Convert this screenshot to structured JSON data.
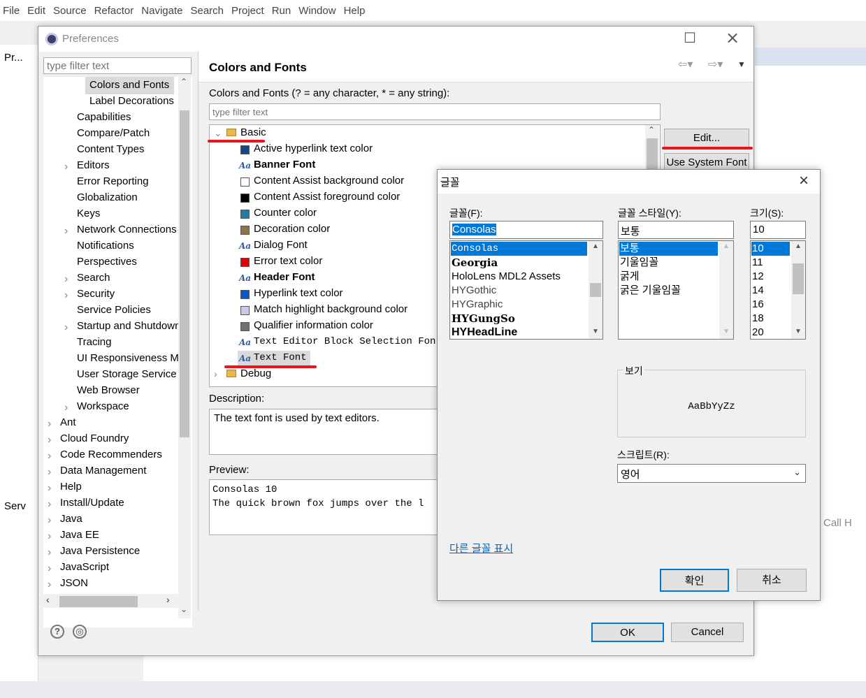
{
  "menu": [
    "File",
    "Edit",
    "Source",
    "Refactor",
    "Navigate",
    "Search",
    "Project",
    "Run",
    "Window",
    "Help"
  ],
  "background": {
    "left_tab": "Pr...",
    "servers_tab": "Serv",
    "call_hierarchy": "Call H"
  },
  "prefs": {
    "title": "Preferences",
    "filter_placeholder": "type filter text",
    "tree": [
      {
        "label": "Colors and Fonts",
        "indent": 3,
        "selected": true
      },
      {
        "label": "Label Decorations",
        "indent": 3
      },
      {
        "label": "Capabilities",
        "indent": 2
      },
      {
        "label": "Compare/Patch",
        "indent": 2
      },
      {
        "label": "Content Types",
        "indent": 2
      },
      {
        "label": "Editors",
        "indent": 2,
        "expandable": true
      },
      {
        "label": "Error Reporting",
        "indent": 2
      },
      {
        "label": "Globalization",
        "indent": 2
      },
      {
        "label": "Keys",
        "indent": 2
      },
      {
        "label": "Network Connections",
        "indent": 2,
        "expandable": true
      },
      {
        "label": "Notifications",
        "indent": 2
      },
      {
        "label": "Perspectives",
        "indent": 2
      },
      {
        "label": "Search",
        "indent": 2,
        "expandable": true
      },
      {
        "label": "Security",
        "indent": 2,
        "expandable": true
      },
      {
        "label": "Service Policies",
        "indent": 2
      },
      {
        "label": "Startup and Shutdown",
        "indent": 2,
        "expandable": true
      },
      {
        "label": "Tracing",
        "indent": 2
      },
      {
        "label": "UI Responsiveness Mc",
        "indent": 2
      },
      {
        "label": "User Storage Service",
        "indent": 2
      },
      {
        "label": "Web Browser",
        "indent": 2
      },
      {
        "label": "Workspace",
        "indent": 2,
        "expandable": true
      },
      {
        "label": "Ant",
        "indent": 1,
        "expandable": true
      },
      {
        "label": "Cloud Foundry",
        "indent": 1,
        "expandable": true
      },
      {
        "label": "Code Recommenders",
        "indent": 1,
        "expandable": true
      },
      {
        "label": "Data Management",
        "indent": 1,
        "expandable": true
      },
      {
        "label": "Help",
        "indent": 1,
        "expandable": true
      },
      {
        "label": "Install/Update",
        "indent": 1,
        "expandable": true
      },
      {
        "label": "Java",
        "indent": 1,
        "expandable": true
      },
      {
        "label": "Java EE",
        "indent": 1,
        "expandable": true
      },
      {
        "label": "Java Persistence",
        "indent": 1,
        "expandable": true
      },
      {
        "label": "JavaScript",
        "indent": 1,
        "expandable": true
      },
      {
        "label": "JSON",
        "indent": 1,
        "expandable": true
      }
    ],
    "page_title": "Colors and Fonts",
    "cf_label": "Colors and Fonts (? = any character, * = any string):",
    "cf_filter_placeholder": "type filter text",
    "cf_tree": [
      {
        "label": "Basic",
        "kind": "folder"
      },
      {
        "label": "Active hyperlink text color",
        "kind": "color",
        "color": "#0e4a8a"
      },
      {
        "label": "Banner Font",
        "kind": "font",
        "bold": true
      },
      {
        "label": "Content Assist background color",
        "kind": "color",
        "color": "#ffffff"
      },
      {
        "label": "Content Assist foreground color",
        "kind": "color",
        "color": "#000000"
      },
      {
        "label": "Counter color",
        "kind": "color",
        "color": "#1a7fa8"
      },
      {
        "label": "Decoration color",
        "kind": "color",
        "color": "#8a7550"
      },
      {
        "label": "Dialog Font",
        "kind": "font"
      },
      {
        "label": "Error text color",
        "kind": "color",
        "color": "#e00000"
      },
      {
        "label": "Header Font",
        "kind": "font",
        "bold": true
      },
      {
        "label": "Hyperlink text color",
        "kind": "color",
        "color": "#0a58c8"
      },
      {
        "label": "Match highlight background color",
        "kind": "color",
        "color": "#c8c8f0"
      },
      {
        "label": "Qualifier information color",
        "kind": "color",
        "color": "#707070"
      },
      {
        "label": "Text Editor Block Selection Font",
        "kind": "font",
        "mono": true
      },
      {
        "label": "Text Font",
        "kind": "font",
        "mono": true,
        "selected": true
      },
      {
        "label": "Debug",
        "kind": "folder"
      }
    ],
    "edit_button": "Edit...",
    "use_system_font_button": "Use System Font",
    "description_label": "Description:",
    "description_text": "The text font is used by text editors.",
    "preview_label": "Preview:",
    "preview_lines": [
      "Consolas 10",
      "The quick brown fox jumps over the l"
    ],
    "ok_button": "OK",
    "cancel_button": "Cancel"
  },
  "font_dialog": {
    "title": "글꼴",
    "font_label": "글꼴(F):",
    "font_value": "Consolas",
    "fonts": [
      "Consolas",
      "Georgia",
      "HoloLens MDL2 Assets",
      "HYGothic",
      "HYGraphic",
      "HYGungSo",
      "HYHeadLine"
    ],
    "style_label": "글꼴 스타일(Y):",
    "style_value": "보통",
    "styles": [
      "보통",
      "기울임꼴",
      "굵게",
      "굵은 기울임꼴"
    ],
    "size_label": "크기(S):",
    "size_value": "10",
    "sizes": [
      "10",
      "11",
      "12",
      "14",
      "16",
      "18",
      "20"
    ],
    "sample_label": "보기",
    "sample_text": "AaBbYyZz",
    "script_label": "스크립트(R):",
    "script_value": "영어",
    "more_fonts": "다른 글꼴 표시",
    "ok": "확인",
    "cancel": "취소"
  },
  "colors": {
    "accent": "#0078d7",
    "highlight_red": "#e8161c",
    "selection": "#dadada"
  }
}
